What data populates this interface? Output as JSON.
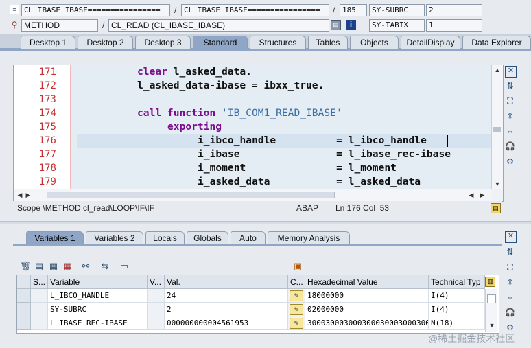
{
  "header": {
    "row1": {
      "program": "CL_IBASE_IBASE================",
      "include": "CL_IBASE_IBASE================",
      "line": "185",
      "sysvar": "SY-SUBRC",
      "sysval": "2"
    },
    "row2": {
      "type": "METHOD",
      "event": "CL_READ (CL_IBASE_IBASE)",
      "sysvar": "SY-TABIX",
      "sysval": "1"
    }
  },
  "tabs_top": [
    "Desktop 1",
    "Desktop 2",
    "Desktop 3",
    "Standard",
    "Structures",
    "Tables",
    "Objects",
    "DetailDisplay",
    "Data Explorer"
  ],
  "tabs_top_active": "Standard",
  "code": {
    "line_numbers": [
      "171",
      "172",
      "173",
      "174",
      "175",
      "176",
      "177",
      "178",
      "179"
    ],
    "lines": [
      {
        "segments": [
          {
            "t": "clear ",
            "c": "kw"
          },
          {
            "t": "l_asked_data.",
            "c": "id"
          }
        ],
        "indent": 10
      },
      {
        "segments": [
          {
            "t": "l_asked_data-ibase = ibxx_true.",
            "c": "id"
          }
        ],
        "indent": 10
      },
      {
        "segments": [],
        "indent": 10
      },
      {
        "segments": [
          {
            "t": "call function ",
            "c": "kw"
          },
          {
            "t": "'IB_COM1_READ_IBASE'",
            "c": "str"
          }
        ],
        "indent": 10
      },
      {
        "segments": [
          {
            "t": "exporting",
            "c": "kw"
          }
        ],
        "indent": 15
      },
      {
        "segments": [
          {
            "t": "i_ibco_handle          = l_ibco_handle",
            "c": "id"
          }
        ],
        "indent": 20
      },
      {
        "segments": [
          {
            "t": "i_ibase                = l_ibase_rec-ibase",
            "c": "id"
          }
        ],
        "indent": 20
      },
      {
        "segments": [
          {
            "t": "i_moment               = l_moment",
            "c": "id"
          }
        ],
        "indent": 20
      },
      {
        "segments": [
          {
            "t": "i_asked_data           = l_asked_data",
            "c": "id"
          }
        ],
        "indent": 20
      }
    ]
  },
  "status": {
    "scope": "Scope \\METHOD cl_read\\LOOP\\IF\\IF",
    "language": "ABAP",
    "position": "Ln 176 Col  53"
  },
  "tabs_bottom": [
    "Variables 1",
    "Variables 2",
    "Locals",
    "Globals",
    "Auto",
    "Memory Analysis"
  ],
  "tabs_bottom_active": "Variables 1",
  "grid": {
    "columns": [
      "S...",
      "Variable",
      "V...",
      "Val.",
      "C...",
      "Hexadecimal Value",
      "Technical Typ"
    ],
    "rows": [
      {
        "variable": "L_IBCO_HANDLE",
        "value": "24",
        "hex": "18000000",
        "type": "I(4)"
      },
      {
        "variable": "SY-SUBRC",
        "value": "2",
        "hex": "02000000",
        "type": "I(4)"
      },
      {
        "variable": "L_IBASE_REC-IBASE",
        "value": "000000000004561953",
        "hex": "3000300030003000300030003000...",
        "type": "N(18)"
      }
    ]
  },
  "watermark": "@稀土掘金技术社区"
}
